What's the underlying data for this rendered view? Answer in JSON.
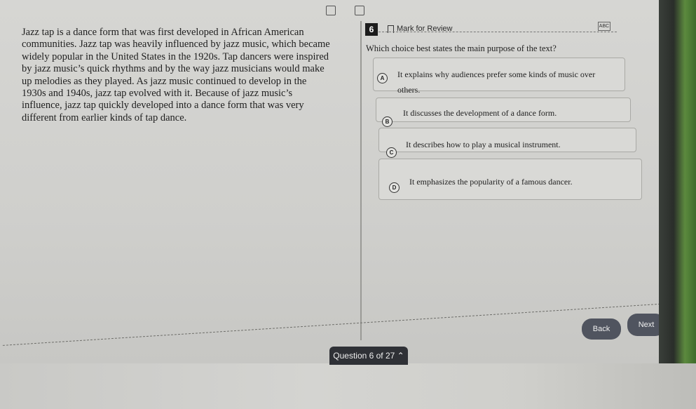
{
  "passage": "Jazz tap is a dance form that was first developed in African American communities. Jazz tap was heavily influenced by jazz music, which became widely popular in the United States in the 1920s. Tap dancers were inspired by jazz music’s quick rhythms and by the way jazz musicians would make up melodies as they played. As jazz music continued to develop in the 1930s and 1940s, jazz tap evolved with it. Because of jazz music’s influence, jazz tap quickly developed into a dance form that was very different from earlier kinds of tap dance.",
  "question_number": "6",
  "mark_for_review": "Mark for Review",
  "abc_label": "ABC",
  "question": "Which choice best states the main purpose of the text?",
  "choices": [
    {
      "letter": "A",
      "text": "It explains why audiences prefer some kinds of music over others."
    },
    {
      "letter": "B",
      "text": "It discusses the development of a dance form."
    },
    {
      "letter": "C",
      "text": "It describes how to play a musical instrument."
    },
    {
      "letter": "D",
      "text": "It emphasizes the popularity of a famous dancer."
    }
  ],
  "back_label": "Back",
  "next_label": "Next",
  "question_progress": "Question 6 of 27",
  "icons": {
    "toolbar_1": "expand-icon",
    "toolbar_2": "layout-icon",
    "bookmark": "bookmark-icon",
    "chevron": "chevron-up-icon"
  }
}
